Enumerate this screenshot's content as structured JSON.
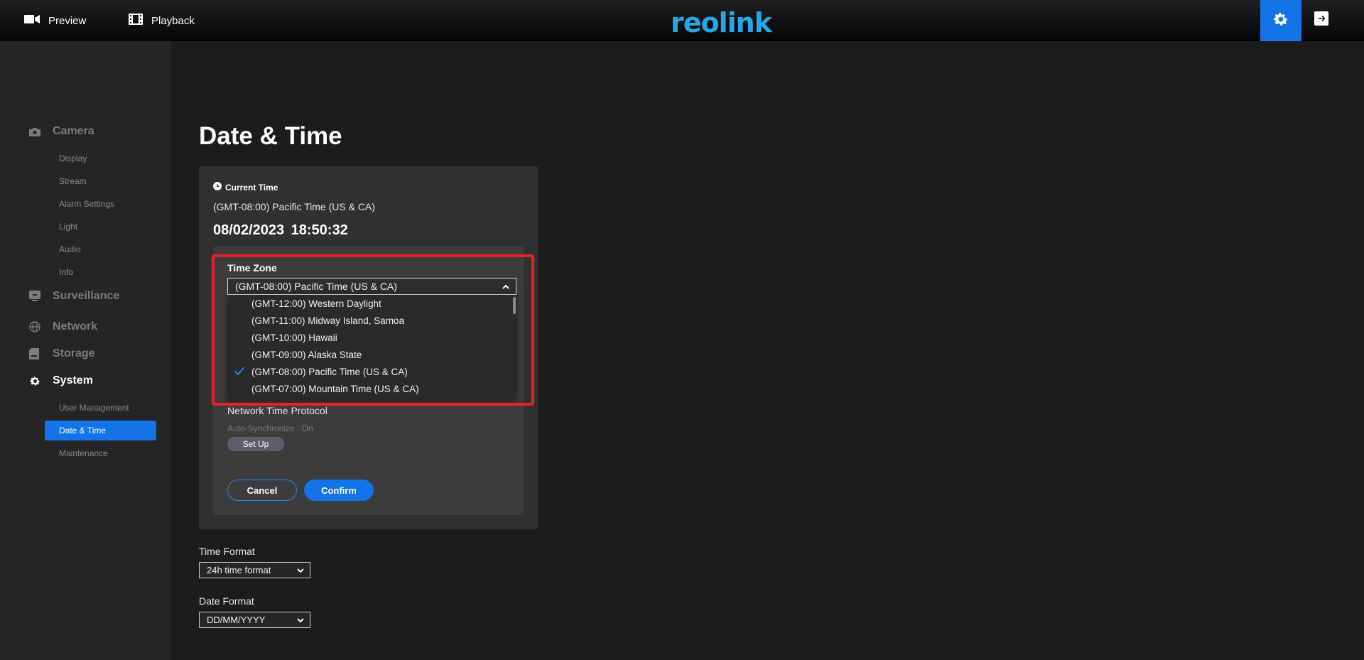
{
  "topbar": {
    "preview_label": "Preview",
    "playback_label": "Playback",
    "logo_text": "reolink",
    "accent_color": "#1373e8",
    "logo_color": "#25a7e8"
  },
  "sidebar": {
    "camera": {
      "label": "Camera",
      "items": [
        "Display",
        "Stream",
        "Alarm Settings",
        "Light",
        "Audio",
        "Info"
      ]
    },
    "surveillance": {
      "label": "Surveillance"
    },
    "network": {
      "label": "Network"
    },
    "storage": {
      "label": "Storage"
    },
    "system": {
      "label": "System",
      "items": [
        "User Management",
        "Date & Time",
        "Maintenance"
      ],
      "active_item": "Date & Time"
    }
  },
  "main": {
    "title": "Date & Time",
    "current_time_label": "Current Time",
    "current_zone": "(GMT-08:00) Pacific Time (US & CA)",
    "current_datetime": "08/02/2023  18:50:32",
    "time_zone": {
      "label": "Time Zone",
      "selected": "(GMT-08:00) Pacific Time (US & CA)",
      "options": [
        "(GMT-12:00) Western Daylight",
        "(GMT-11:00) Midway Island, Samoa",
        "(GMT-10:00) Hawaii",
        "(GMT-09:00) Alaska State",
        "(GMT-08:00) Pacific Time (US & CA)",
        "(GMT-07:00) Mountain Time (US & CA)"
      ],
      "checked_index": 4
    },
    "ntp": {
      "label": "Network Time Protocol",
      "status": "Auto-Synchronize : On",
      "setup_label": "Set Up"
    },
    "cancel_label": "Cancel",
    "confirm_label": "Confirm",
    "time_format": {
      "label": "Time Format",
      "value": "24h time format"
    },
    "date_format": {
      "label": "Date Format",
      "value": "DD/MM/YYYY"
    }
  }
}
